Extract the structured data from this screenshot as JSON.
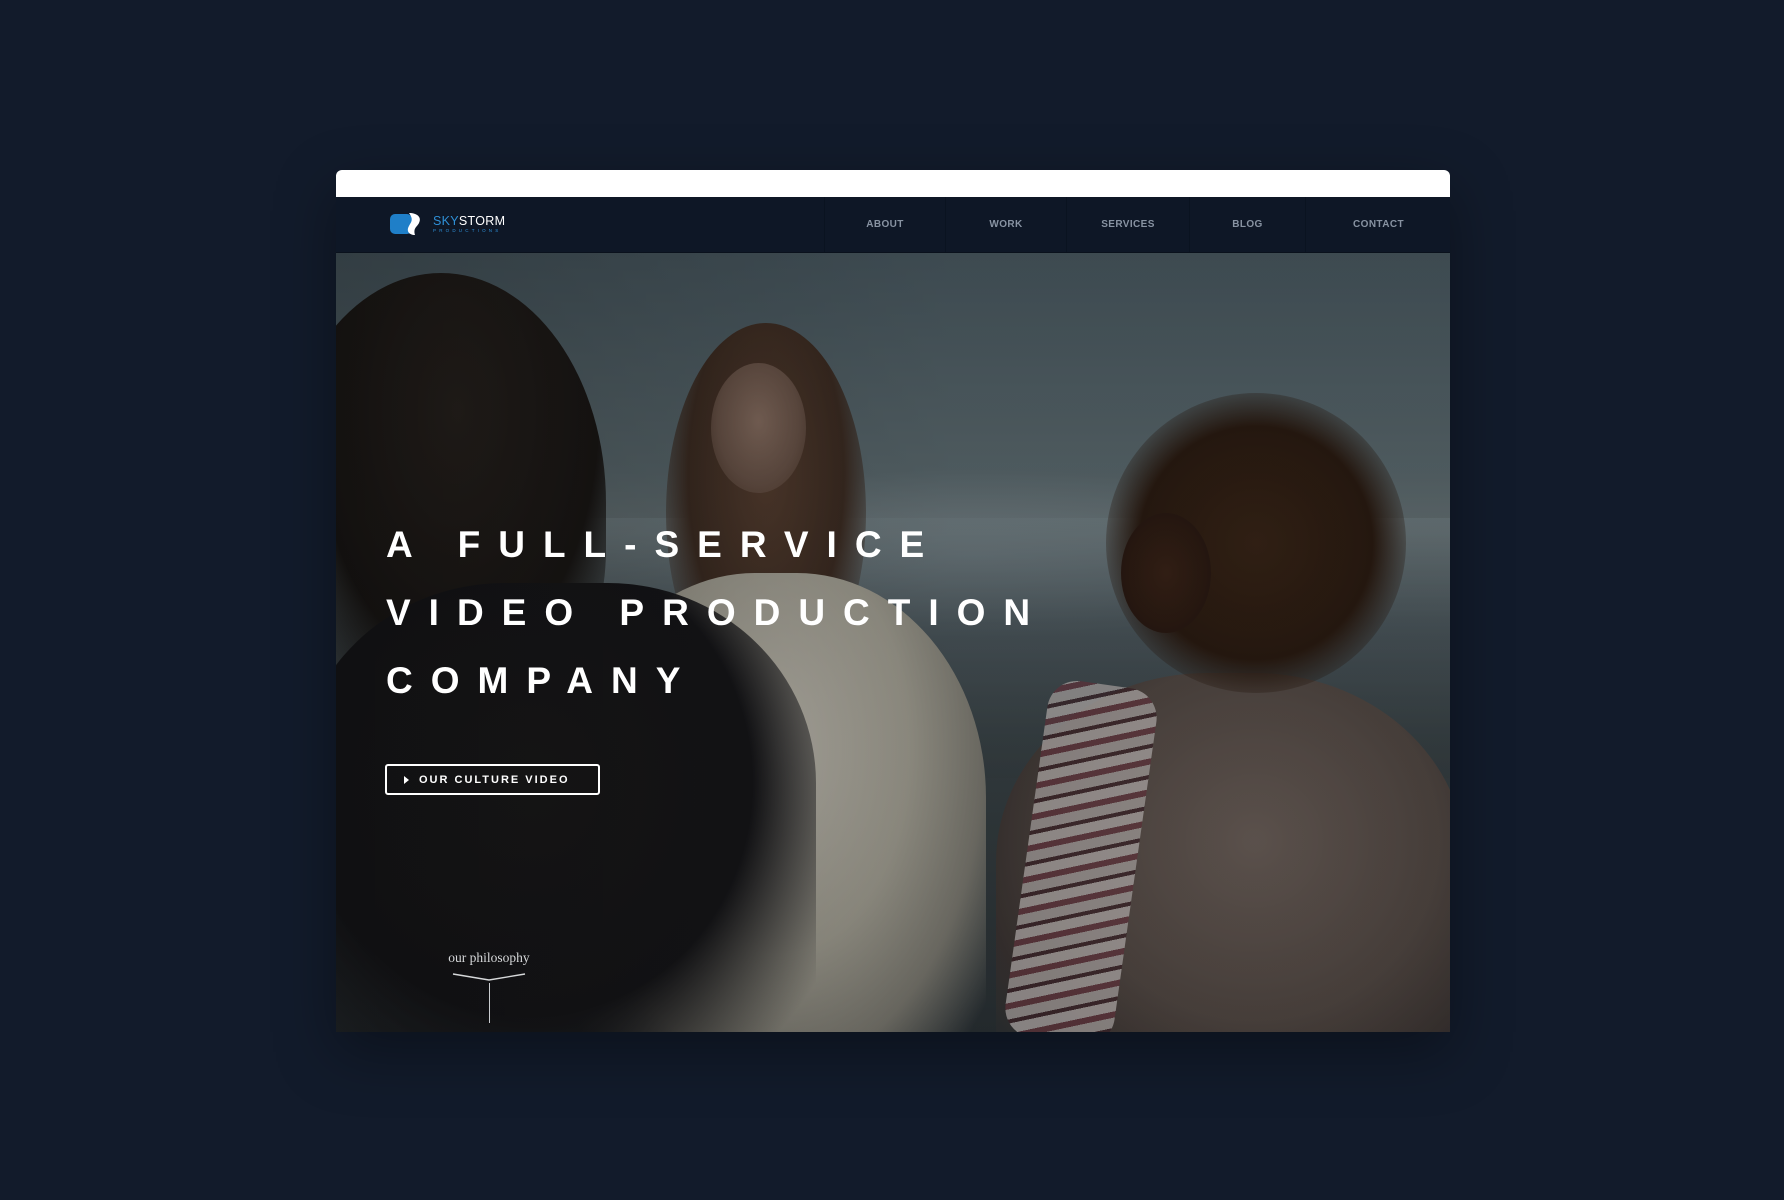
{
  "brand": {
    "name_part1": "SKY",
    "name_part2": "STORM",
    "tagline": "PRODUCTIONS",
    "accent_color": "#2e8fd6"
  },
  "nav": {
    "items": [
      {
        "label": "ABOUT"
      },
      {
        "label": "WORK"
      },
      {
        "label": "SERVICES"
      },
      {
        "label": "BLOG"
      },
      {
        "label": "CONTACT"
      }
    ]
  },
  "hero": {
    "title_lines": [
      "A FULL-SERVICE",
      "VIDEO PRODUCTION",
      "COMPANY"
    ],
    "cta": {
      "label": "OUR CULTURE VIDEO",
      "icon": "play-icon"
    },
    "scroll_link": {
      "label": "our philosophy",
      "icon": "chevron-down-icon"
    }
  },
  "colors": {
    "page_background": "#121b2b",
    "nav_background": "#0e1726",
    "nav_text": "#8893a2"
  }
}
